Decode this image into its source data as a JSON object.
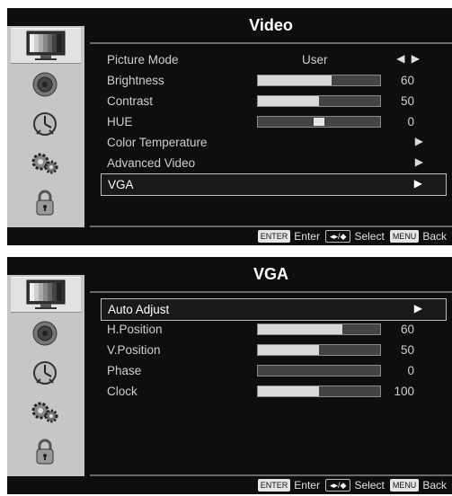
{
  "menus": [
    {
      "title": "Video",
      "items": [
        {
          "label": "Picture Mode",
          "kind": "mode",
          "value": "User",
          "arrow": "◀ ▶"
        },
        {
          "label": "Brightness",
          "kind": "slider",
          "value": "60",
          "level": 0.6
        },
        {
          "label": "Contrast",
          "kind": "slider",
          "value": "50",
          "level": 0.5
        },
        {
          "label": "HUE",
          "kind": "knob",
          "value": "0",
          "level": 0.5
        },
        {
          "label": "Color Temperature",
          "kind": "submenu",
          "arrow": "▶"
        },
        {
          "label": "Advanced Video",
          "kind": "submenu",
          "arrow": "▶"
        },
        {
          "label": "VGA",
          "kind": "submenu",
          "arrow": "▶",
          "selected": true
        }
      ]
    },
    {
      "title": "VGA",
      "items": [
        {
          "label": "Auto Adjust",
          "kind": "submenu",
          "arrow": "▶",
          "selected": true
        },
        {
          "label": "H.Position",
          "kind": "slider",
          "value": "60",
          "level": 0.69
        },
        {
          "label": "V.Position",
          "kind": "slider",
          "value": "50",
          "level": 0.5
        },
        {
          "label": "Phase",
          "kind": "slider",
          "value": "0",
          "level": 0.0
        },
        {
          "label": "Clock",
          "kind": "slider",
          "value": "100",
          "level": 0.5
        }
      ]
    }
  ],
  "sidebar_icons": [
    "tv-picture-icon",
    "speaker-icon",
    "clock-icon",
    "gears-icon",
    "padlock-icon"
  ],
  "footer": {
    "enter_key": "ENTER",
    "enter_label": "Enter",
    "nav_key": "◂▸/◆",
    "select_label": "Select",
    "menu_key": "MENU",
    "back_label": "Back"
  },
  "colors": {
    "background": "#0e0e0e",
    "sidebar": "#c6c6c6",
    "text": "#cfcfcf",
    "bar_fill": "#d9d9d9"
  }
}
